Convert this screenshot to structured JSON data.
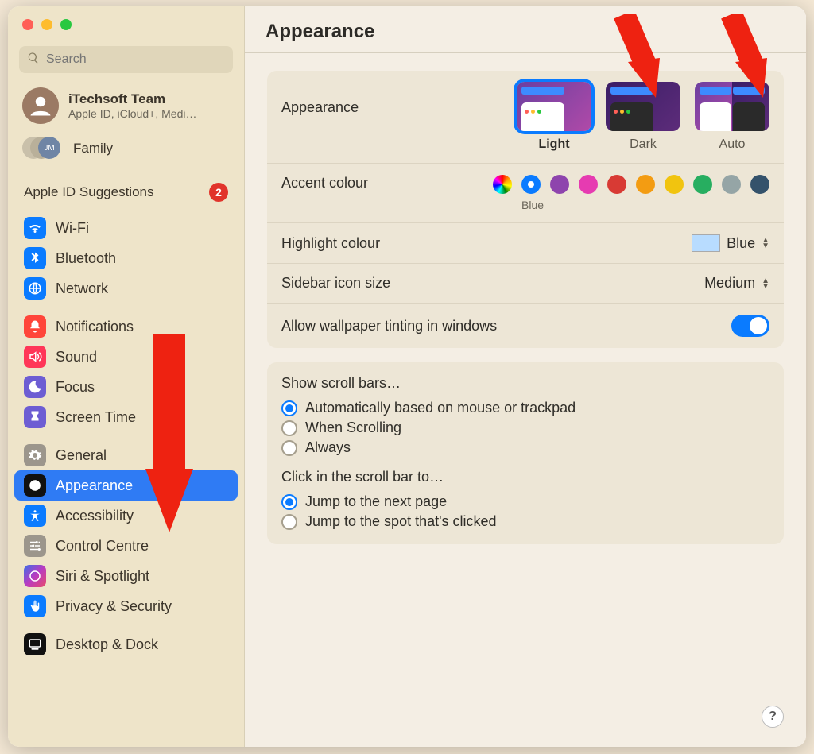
{
  "header": {
    "title": "Appearance"
  },
  "search": {
    "placeholder": "Search"
  },
  "account": {
    "name": "iTechsoft Team",
    "sub": "Apple ID, iCloud+, Medi…"
  },
  "family": {
    "label": "Family",
    "badge_text": "JM"
  },
  "suggestions": {
    "label": "Apple ID Suggestions",
    "count": "2"
  },
  "sidebar": {
    "items": [
      {
        "label": "Wi-Fi"
      },
      {
        "label": "Bluetooth"
      },
      {
        "label": "Network"
      },
      {
        "label": "Notifications"
      },
      {
        "label": "Sound"
      },
      {
        "label": "Focus"
      },
      {
        "label": "Screen Time"
      },
      {
        "label": "General"
      },
      {
        "label": "Appearance"
      },
      {
        "label": "Accessibility"
      },
      {
        "label": "Control Centre"
      },
      {
        "label": "Siri & Spotlight"
      },
      {
        "label": "Privacy & Security"
      },
      {
        "label": "Desktop & Dock"
      }
    ]
  },
  "appearance": {
    "row_label": "Appearance",
    "options": [
      {
        "label": "Light"
      },
      {
        "label": "Dark"
      },
      {
        "label": "Auto"
      }
    ]
  },
  "accent": {
    "row_label": "Accent colour",
    "selected_name": "Blue",
    "colors": [
      "conic-gradient(red,orange,yellow,green,cyan,blue,magenta,red)",
      "#0a7bff",
      "#8e44ad",
      "#e63bb1",
      "#d83a34",
      "#f39c12",
      "#f1c40f",
      "#27ae60",
      "#95a5a6",
      "#34526b"
    ]
  },
  "highlight": {
    "row_label": "Highlight colour",
    "value": "Blue"
  },
  "sidebarsize": {
    "row_label": "Sidebar icon size",
    "value": "Medium"
  },
  "tint": {
    "row_label": "Allow wallpaper tinting in windows"
  },
  "scroll": {
    "title": "Show scroll bars…",
    "options": [
      {
        "label": "Automatically based on mouse or trackpad"
      },
      {
        "label": "When Scrolling"
      },
      {
        "label": "Always"
      }
    ]
  },
  "click": {
    "title": "Click in the scroll bar to…",
    "options": [
      {
        "label": "Jump to the next page"
      },
      {
        "label": "Jump to the spot that's clicked"
      }
    ]
  },
  "help": {
    "label": "?"
  }
}
